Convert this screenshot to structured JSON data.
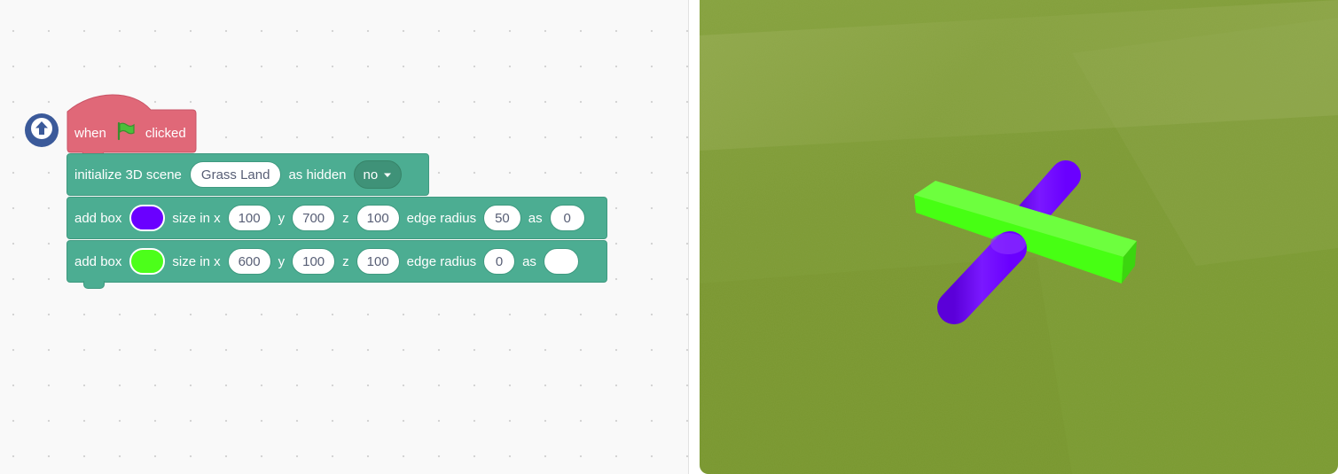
{
  "hat_block": {
    "label_before": "when",
    "flag_icon": "green-flag-icon",
    "label_after": "clicked"
  },
  "init_block": {
    "label": "initialize 3D scene",
    "scene_value": "Grass Land",
    "hidden_label": "as hidden",
    "hidden_value": "no"
  },
  "box_blocks": [
    {
      "label": "add box",
      "color": "#6a00ff",
      "size_label": "size in x",
      "x": "100",
      "y_label": "y",
      "y": "700",
      "z_label": "z",
      "z": "100",
      "radius_label": "edge radius",
      "radius": "50",
      "as_label": "as",
      "as_value": "0"
    },
    {
      "label": "add box",
      "color": "#4cff1a",
      "size_label": "size in x",
      "x": "600",
      "y_label": "y",
      "y": "100",
      "z_label": "z",
      "z": "100",
      "radius_label": "edge radius",
      "radius": "0",
      "as_label": "as",
      "as_value": ""
    }
  ],
  "colors": {
    "hat_block": "#e06878",
    "stack_block": "#4cad92",
    "up_button": "#3b5a9a",
    "grass": "#7e9b35"
  },
  "icons": [
    "arrow-up-icon",
    "green-flag-icon",
    "caret-down-icon"
  ]
}
